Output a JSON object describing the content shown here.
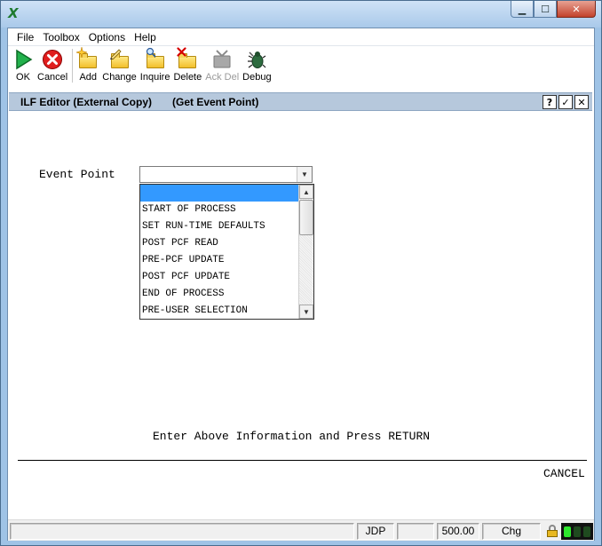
{
  "menubar": {
    "items": [
      "File",
      "Toolbox",
      "Options",
      "Help"
    ]
  },
  "toolbar": {
    "ok": "OK",
    "cancel": "Cancel",
    "add": "Add",
    "change": "Change",
    "inquire": "Inquire",
    "delete": "Delete",
    "ack_del": "Ack Del",
    "debug": "Debug"
  },
  "panel": {
    "title": "ILF Editor (External Copy)",
    "subtitle": "(Get Event Point)",
    "help_btn": "?",
    "ok_btn": "✓",
    "close_btn": "✕"
  },
  "form": {
    "event_point_label": "Event Point",
    "event_point_value": "",
    "options": [
      "",
      "START OF PROCESS",
      "SET RUN-TIME DEFAULTS",
      "POST PCF READ",
      "PRE-PCF UPDATE",
      "POST PCF UPDATE",
      "END OF PROCESS",
      "PRE-USER SELECTION"
    ],
    "prompt": "Enter Above Information and Press RETURN",
    "cancel_command": "CANCEL"
  },
  "statusbar": {
    "user": "JDP",
    "value": "500.00",
    "mode": "Chg"
  },
  "colors": {
    "selection": "#3399ff",
    "panel_header": "#b6c8dc",
    "light_green": "#2ee82e",
    "light_dim": "#1f4a1f"
  }
}
